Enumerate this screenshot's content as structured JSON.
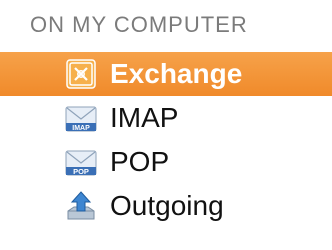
{
  "sidebar": {
    "section_title": "ON MY COMPUTER",
    "selected_color": "#f08a2a",
    "items": [
      {
        "label": "Exchange",
        "icon": "exchange-icon",
        "selected": true
      },
      {
        "label": "IMAP",
        "icon": "imap-mail-icon",
        "icon_text": "IMAP",
        "selected": false
      },
      {
        "label": "POP",
        "icon": "pop-mail-icon",
        "icon_text": "POP",
        "selected": false
      },
      {
        "label": "Outgoing",
        "icon": "outgoing-upload-icon",
        "selected": false
      }
    ]
  }
}
